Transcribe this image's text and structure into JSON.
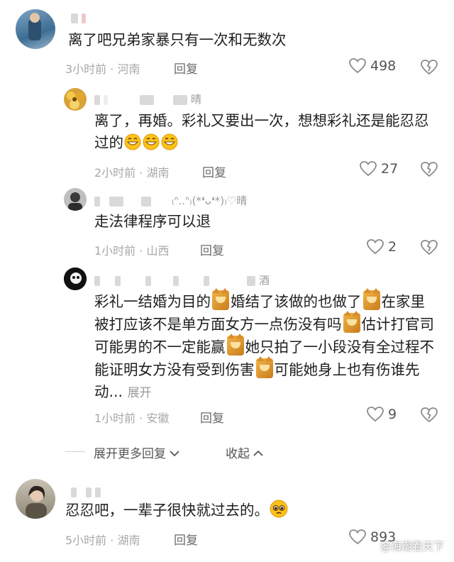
{
  "comments": [
    {
      "text": "离了吧兄弟家暴只有一次和无数次",
      "meta": "3小时前 · 河南",
      "reply_label": "回复",
      "likes": "498"
    },
    {
      "nick_tail": "晴",
      "text": "离了，再婚。彩礼又要出一次，想想彩礼还是能忍忍过的",
      "meta": "2小时前 · 湖南",
      "reply_label": "回复",
      "likes": "27"
    },
    {
      "nick_tail": "₍ᐢ..ᐢ₎(*❛ᴗ❛*)₎♡晴",
      "text": "走法律程序可以退",
      "meta": "1小时前 · 山西",
      "reply_label": "回复",
      "likes": "2"
    },
    {
      "nick_tail": "酒",
      "text_parts": [
        "彩礼一结婚为目的",
        "婚结了该做的也做了",
        "在家里被打应该不是单方面女方一点伤没有吗",
        "估计打官司可能男的不一定能赢",
        "她只拍了一小段没有全过程不能证明女方没有受到伤害",
        "可能她身上也有伤谁先动..."
      ],
      "expand_label": "展开",
      "meta": "1小时前 · 安徽",
      "reply_label": "回复",
      "likes": "9"
    },
    {
      "text": "忍忍吧，一辈子很快就过去的。",
      "meta": "5小时前 · 湖南",
      "reply_label": "回复",
      "likes": "893"
    }
  ],
  "thread_controls": {
    "expand_more": "展开更多回复",
    "collapse": "收起"
  },
  "watermark": "@海潮看天下",
  "colors": {
    "text": "#1e1e1e",
    "meta": "#a8a8a8",
    "reply": "#6b6b6b"
  },
  "icons": [
    "heart-outline-icon",
    "broken-heart-icon",
    "chevron-down-icon",
    "chevron-up-icon",
    "grin-emoji-icon",
    "pleading-emoji-icon",
    "cat-sticker-icon"
  ]
}
